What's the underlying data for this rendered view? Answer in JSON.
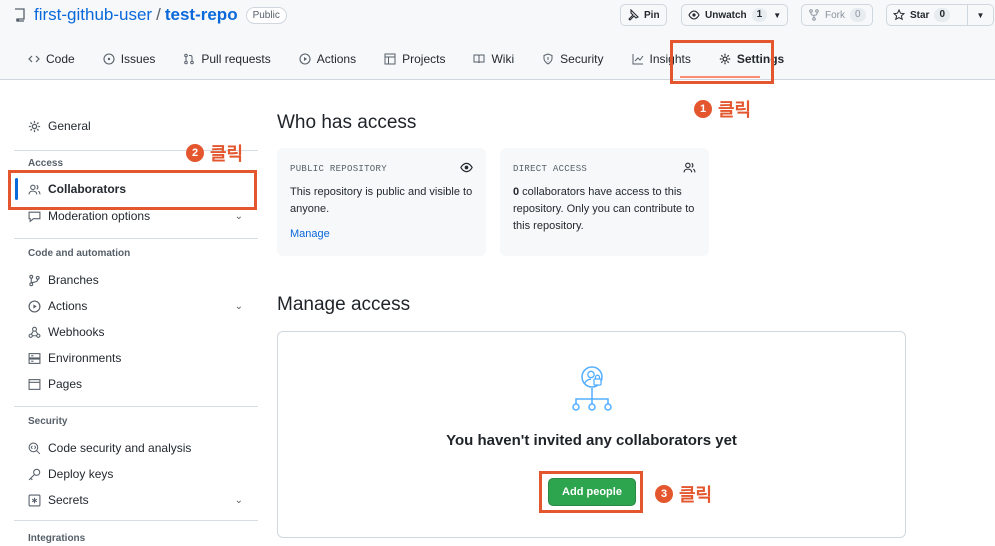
{
  "repo": {
    "owner": "first-github-user",
    "separator": "/",
    "name": "test-repo",
    "visibility": "Public"
  },
  "header_actions": {
    "pin": "Pin",
    "unwatch": "Unwatch",
    "unwatch_count": "1",
    "fork": "Fork",
    "fork_count": "0",
    "star": "Star",
    "star_count": "0"
  },
  "tabs": [
    {
      "label": "Code",
      "icon": "code-icon"
    },
    {
      "label": "Issues",
      "icon": "issue-icon"
    },
    {
      "label": "Pull requests",
      "icon": "pull-request-icon"
    },
    {
      "label": "Actions",
      "icon": "play-icon"
    },
    {
      "label": "Projects",
      "icon": "table-icon"
    },
    {
      "label": "Wiki",
      "icon": "book-icon"
    },
    {
      "label": "Security",
      "icon": "shield-icon"
    },
    {
      "label": "Insights",
      "icon": "graph-icon"
    },
    {
      "label": "Settings",
      "icon": "gear-icon",
      "active": true
    }
  ],
  "sidebar": {
    "general": "General",
    "access_heading": "Access",
    "collaborators": "Collaborators",
    "moderation": "Moderation options",
    "code_heading": "Code and automation",
    "branches": "Branches",
    "actions": "Actions",
    "webhooks": "Webhooks",
    "environments": "Environments",
    "pages": "Pages",
    "security_heading": "Security",
    "code_security": "Code security and analysis",
    "deploy_keys": "Deploy keys",
    "secrets": "Secrets",
    "integrations_heading": "Integrations"
  },
  "main": {
    "who_title": "Who has access",
    "public_box": {
      "label": "PUBLIC REPOSITORY",
      "text": "This repository is public and visible to anyone.",
      "link": "Manage"
    },
    "direct_box": {
      "label": "DIRECT ACCESS",
      "count": "0",
      "text": " collaborators have access to this repository. Only you can contribute to this repository."
    },
    "manage_title": "Manage access",
    "empty_text": "You haven't invited any collaborators yet",
    "add_button": "Add people"
  },
  "annotations": [
    {
      "num": "1",
      "text": "클릭"
    },
    {
      "num": "2",
      "text": "클릭"
    },
    {
      "num": "3",
      "text": "클릭"
    }
  ],
  "colors": {
    "highlight": "#e4572e",
    "link": "#0969da",
    "primary_button": "#2da44e",
    "tab_underline": "#fd8c73"
  }
}
